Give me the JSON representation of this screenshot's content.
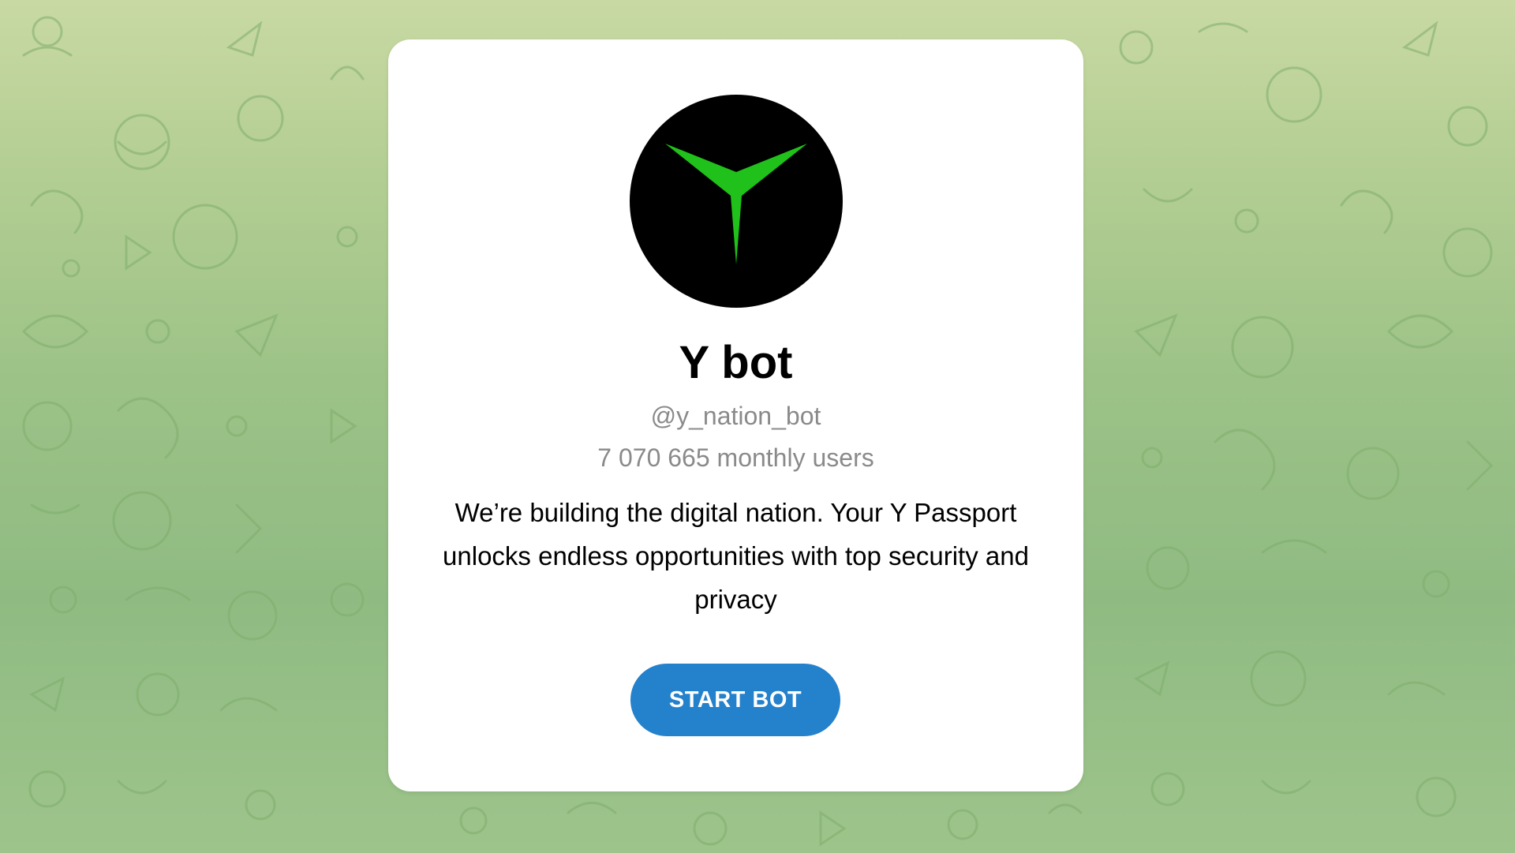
{
  "bot": {
    "name": "Y bot",
    "username": "@y_nation_bot",
    "monthly_users": "7 070 665 monthly users",
    "description": "We’re building the digital nation. Your Y Passport unlocks endless opportunities with top security and privacy",
    "avatar_icon": "y-logo-icon"
  },
  "actions": {
    "start_label": "START BOT"
  },
  "colors": {
    "button": "#2481cc",
    "logo_green": "#1fc11a",
    "avatar_bg": "#000000",
    "background": "#a8c98e"
  }
}
